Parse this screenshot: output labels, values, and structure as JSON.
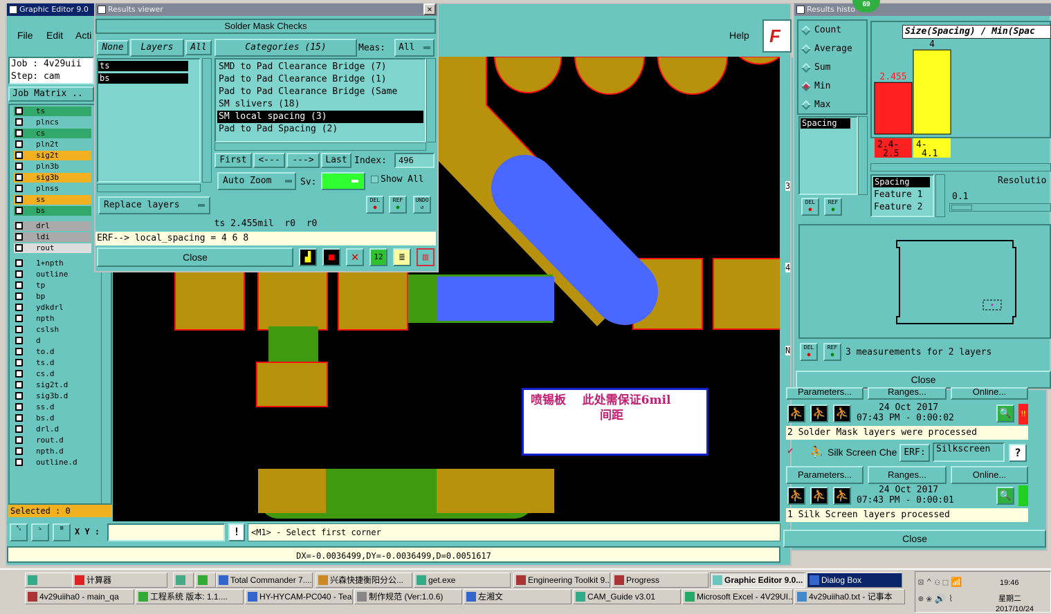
{
  "editor": {
    "title": "Graphic Editor 9.0",
    "menu": [
      "File",
      "Edit",
      "Acti"
    ],
    "help": "Help",
    "job": "Job : 4v29uii",
    "step": "Step: cam",
    "job_matrix": "Job Matrix ..",
    "selected": "Selected : 0",
    "xy_label": "X Y :",
    "status_msg": "<M1> - Select first corner",
    "coords": "DX=-0.0036499,DY=-0.0036499,D=0.0051617"
  },
  "layers": [
    {
      "name": "ts",
      "color": "#32a86a"
    },
    {
      "name": "plncs",
      "color": "#6cc6c0"
    },
    {
      "name": "cs",
      "color": "#32a86a"
    },
    {
      "name": "pln2t",
      "color": "#6cc6c0"
    },
    {
      "name": "sig2t",
      "color": "#f0b020"
    },
    {
      "name": "pln3b",
      "color": "#6cc6c0"
    },
    {
      "name": "sig3b",
      "color": "#f0b020"
    },
    {
      "name": "plnss",
      "color": "#6cc6c0"
    },
    {
      "name": "ss",
      "color": "#f0b020"
    },
    {
      "name": "bs",
      "color": "#32a86a"
    },
    {
      "name": "drl",
      "color": "#aaaaaa"
    },
    {
      "name": "ldi",
      "color": "#aaaaaa"
    },
    {
      "name": "rout",
      "color": "#dddddd"
    },
    {
      "name": "1+npth",
      "color": "#6cc6c0"
    },
    {
      "name": "outline",
      "color": "#6cc6c0"
    },
    {
      "name": "tp",
      "color": "#6cc6c0"
    },
    {
      "name": "bp",
      "color": "#6cc6c0"
    },
    {
      "name": "ydkdrl",
      "color": "#6cc6c0"
    },
    {
      "name": "npth",
      "color": "#6cc6c0"
    },
    {
      "name": "cslsh",
      "color": "#6cc6c0"
    },
    {
      "name": "d",
      "color": "#6cc6c0"
    },
    {
      "name": "to.d",
      "color": "#6cc6c0"
    },
    {
      "name": "ts.d",
      "color": "#6cc6c0"
    },
    {
      "name": "cs.d",
      "color": "#6cc6c0"
    },
    {
      "name": "sig2t.d",
      "color": "#6cc6c0"
    },
    {
      "name": "sig3b.d",
      "color": "#6cc6c0"
    },
    {
      "name": "ss.d",
      "color": "#6cc6c0"
    },
    {
      "name": "bs.d",
      "color": "#6cc6c0"
    },
    {
      "name": "drl.d",
      "color": "#6cc6c0"
    },
    {
      "name": "rout.d",
      "color": "#6cc6c0"
    },
    {
      "name": "npth.d",
      "color": "#6cc6c0"
    },
    {
      "name": "outline.d",
      "color": "#6cc6c0"
    }
  ],
  "viewer": {
    "title": "Results viewer",
    "header": "Solder Mask Checks",
    "none": "None",
    "layers_label": "Layers",
    "all": "All",
    "categories_label": "Categories (15)",
    "meas_label": "Meas:",
    "meas_value": "All",
    "layer_list": [
      "ts",
      "bs"
    ],
    "categories": [
      "SMD to Pad Clearance Bridge (7)",
      "Pad to Pad Clearance Bridge (1)",
      "Pad to Pad Clearance Bridge (Same",
      "SM slivers (18)",
      "SM local spacing (3)",
      "Pad to Pad Spacing (2)"
    ],
    "first": "First",
    "prev": "<---",
    "next": "--->",
    "last": "Last",
    "index_label": "Index:",
    "index_value": "496",
    "auto_zoom": "Auto Zoom",
    "sv_label": "Sv:",
    "show_all": "Show All",
    "replace_layers": "Replace layers",
    "icon_del": "DEL",
    "icon_ref": "REF",
    "icon_undo": "UNDO",
    "measure": "ts 2.455mil  r0  r0",
    "erf": "ERF--> local_spacing = 4 6 8",
    "close": "Close"
  },
  "annotation": {
    "line1": "喷锡板    此处需保证6mil",
    "line2": "间距"
  },
  "history": {
    "title": "Results histo",
    "badge": "69",
    "stats": [
      "Count",
      "Average",
      "Sum",
      "Min",
      "Max"
    ],
    "selected_stat": "Min",
    "list_item": "Spacing",
    "chart_title": "Size(Spacing) / Min(Spac",
    "legend_cols": [
      "Spacing",
      "Feature 1",
      "Feature 2"
    ],
    "resolution_label": "Resolutio",
    "resolution_value": "0.1",
    "summary": "3 measurements for 2 layers",
    "close": "Close"
  },
  "chart_data": {
    "type": "bar",
    "title": "Size(Spacing) / Min(Spac",
    "categories": [
      "2.4-2.5",
      "4-4.1"
    ],
    "values": [
      2.455,
      4
    ],
    "colors": [
      "#ff2020",
      "#ffff20"
    ],
    "ylim": [
      0,
      4.4
    ]
  },
  "checklist": {
    "params": "Parameters...",
    "ranges": "Ranges...",
    "online": "Online...",
    "sm_date": "24 Oct 2017",
    "sm_time": "07:43 PM - 0:00:02",
    "sm_result": "2 Solder Mask layers were processed",
    "ss_name": "Silk Screen Che",
    "erf_label": "ERF:",
    "erf_value": "Silkscreen",
    "help": "?",
    "ss_date": "24 Oct 2017",
    "ss_time": "07:43 PM - 0:00:01",
    "ss_result": "1 Silk Screen layers processed",
    "close": "Close",
    "side_nums": [
      "3",
      "4",
      "N"
    ]
  },
  "taskbar": {
    "row1": [
      "计算器",
      "",
      "",
      "Total Commander 7....",
      "兴森快捷衡阳分公...",
      "get.exe",
      "Engineering Toolkit 9...",
      "Progress",
      "Graphic Editor 9.0...",
      "Dialog Box"
    ],
    "row2": [
      "4v29uiiha0 - main_qa",
      "工程系统  版本: 1.1....",
      "HY-HYCAM-PC040 - Tea...",
      "制作规范 (Ver:1.0.6)",
      "左湘文",
      "CAM_Guide v3.01",
      "Microsoft Excel - 4V29UI...",
      "4v29uiiha0.txt - 记事本"
    ],
    "time": "19:46",
    "weekday": "星期二",
    "date": "2017/10/24"
  }
}
